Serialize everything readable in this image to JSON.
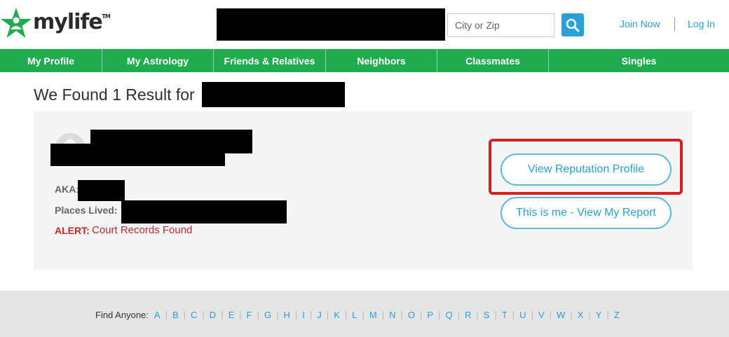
{
  "header": {
    "logo_text": "mylife",
    "logo_tm": "TM",
    "search_placeholder": "City or Zip",
    "join_label": "Join Now",
    "login_label": "Log In"
  },
  "nav": {
    "items": [
      {
        "label": "My Profile"
      },
      {
        "label": "My Astrology"
      },
      {
        "label": "Friends & Relatives"
      },
      {
        "label": "Neighbors"
      },
      {
        "label": "Classmates"
      },
      {
        "label": "Singles"
      }
    ]
  },
  "results": {
    "heading": "We Found 1 Result for",
    "aka_label": "AKA:",
    "places_label": "Places Lived:",
    "alert_label": "ALERT:",
    "alert_text": "Court Records Found",
    "view_profile_label": "View Reputation Profile",
    "this_is_me_label": "This is me - View My Report"
  },
  "footer": {
    "find_label": "Find Anyone:",
    "letters": [
      "A",
      "B",
      "C",
      "D",
      "E",
      "F",
      "G",
      "H",
      "I",
      "J",
      "K",
      "L",
      "M",
      "N",
      "O",
      "P",
      "Q",
      "R",
      "S",
      "T",
      "U",
      "V",
      "W",
      "X",
      "Y",
      "Z"
    ]
  },
  "colors": {
    "brand_green": "#1fab4e",
    "link_blue": "#2a9fd8",
    "alert_red": "#c1272d",
    "highlight_red": "#d61f1f"
  }
}
